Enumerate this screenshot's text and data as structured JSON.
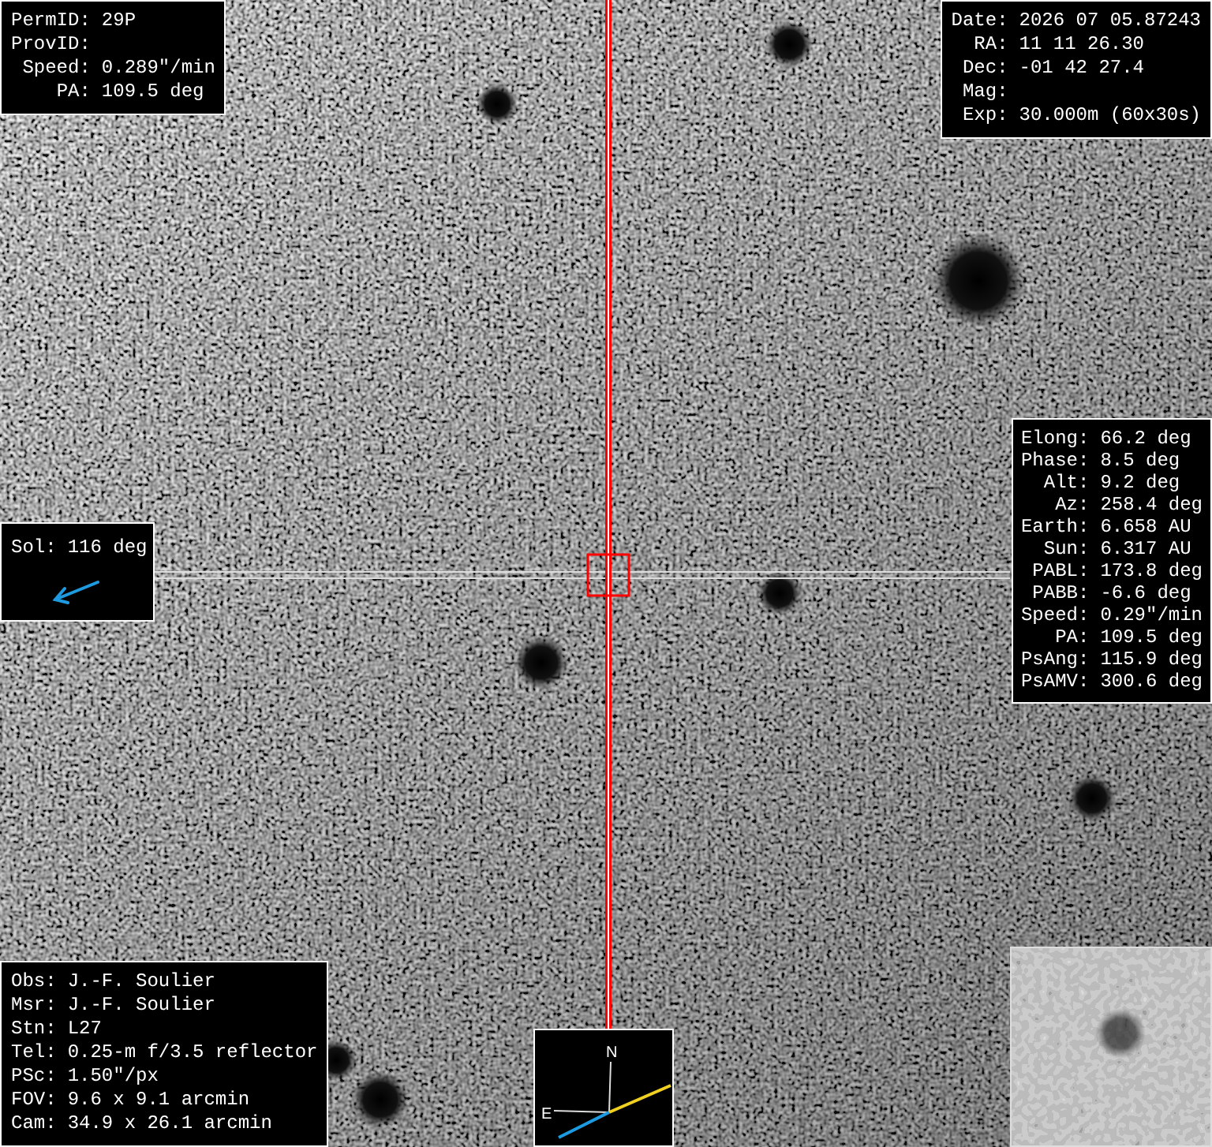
{
  "target_panel": {
    "lines": [
      {
        "label": "PermID:",
        "value": "29P"
      },
      {
        "label": "ProvID:"
      },
      {
        "label": "Speed:",
        "value": "0.289\"/min"
      },
      {
        "label": "PA:",
        "value": "109.5 deg"
      }
    ]
  },
  "observation_panel": {
    "lines": [
      {
        "label": "Date:",
        "value": "2026 07 05.87243"
      },
      {
        "label": "RA:",
        "value": "11 11 26.30"
      },
      {
        "label": "Dec:",
        "value": "-01 42 27.4"
      },
      {
        "label": "Mag:"
      },
      {
        "label": "Exp:",
        "value": "30.000m (60x30s)"
      }
    ]
  },
  "ephemeris_panel": {
    "lines": [
      {
        "label": "Elong:",
        "value": "66.2 deg"
      },
      {
        "label": "Phase:",
        "value": "8.5 deg"
      },
      {
        "label": "Alt:",
        "value": "9.2 deg"
      },
      {
        "label": "Az:",
        "value": "258.4 deg"
      },
      {
        "label": "Earth:",
        "value": "6.658 AU"
      },
      {
        "label": "Sun:",
        "value": "6.317 AU"
      },
      {
        "label": "PABL:",
        "value": "173.8 deg"
      },
      {
        "label": "PABB:",
        "value": "-6.6 deg"
      },
      {
        "label": "Speed:",
        "value": "0.29\"/min"
      },
      {
        "label": "PA:",
        "value": "109.5 deg"
      },
      {
        "label": "PsAng:",
        "value": "115.9 deg"
      },
      {
        "label": "PsAMV:",
        "value": "300.6 deg"
      }
    ]
  },
  "sun_direction_panel": {
    "label": "Sol:",
    "value": "116 deg"
  },
  "observer_panel": {
    "lines": [
      {
        "label": "Obs:",
        "value": "J.-F. Soulier"
      },
      {
        "label": "Msr:",
        "value": "J.-F. Soulier"
      },
      {
        "label": "Stn:",
        "value": "L27"
      },
      {
        "label": "Tel:",
        "value": "0.25-m f/3.5 reflector"
      },
      {
        "label": "PSc:",
        "value": "1.50\"/px"
      },
      {
        "label": "FOV:",
        "value": "9.6 x 9.1 arcmin"
      },
      {
        "label": "Cam:",
        "value": "34.9 x 26.1 arcmin"
      }
    ]
  },
  "compass": {
    "north": "N",
    "east": "E"
  }
}
